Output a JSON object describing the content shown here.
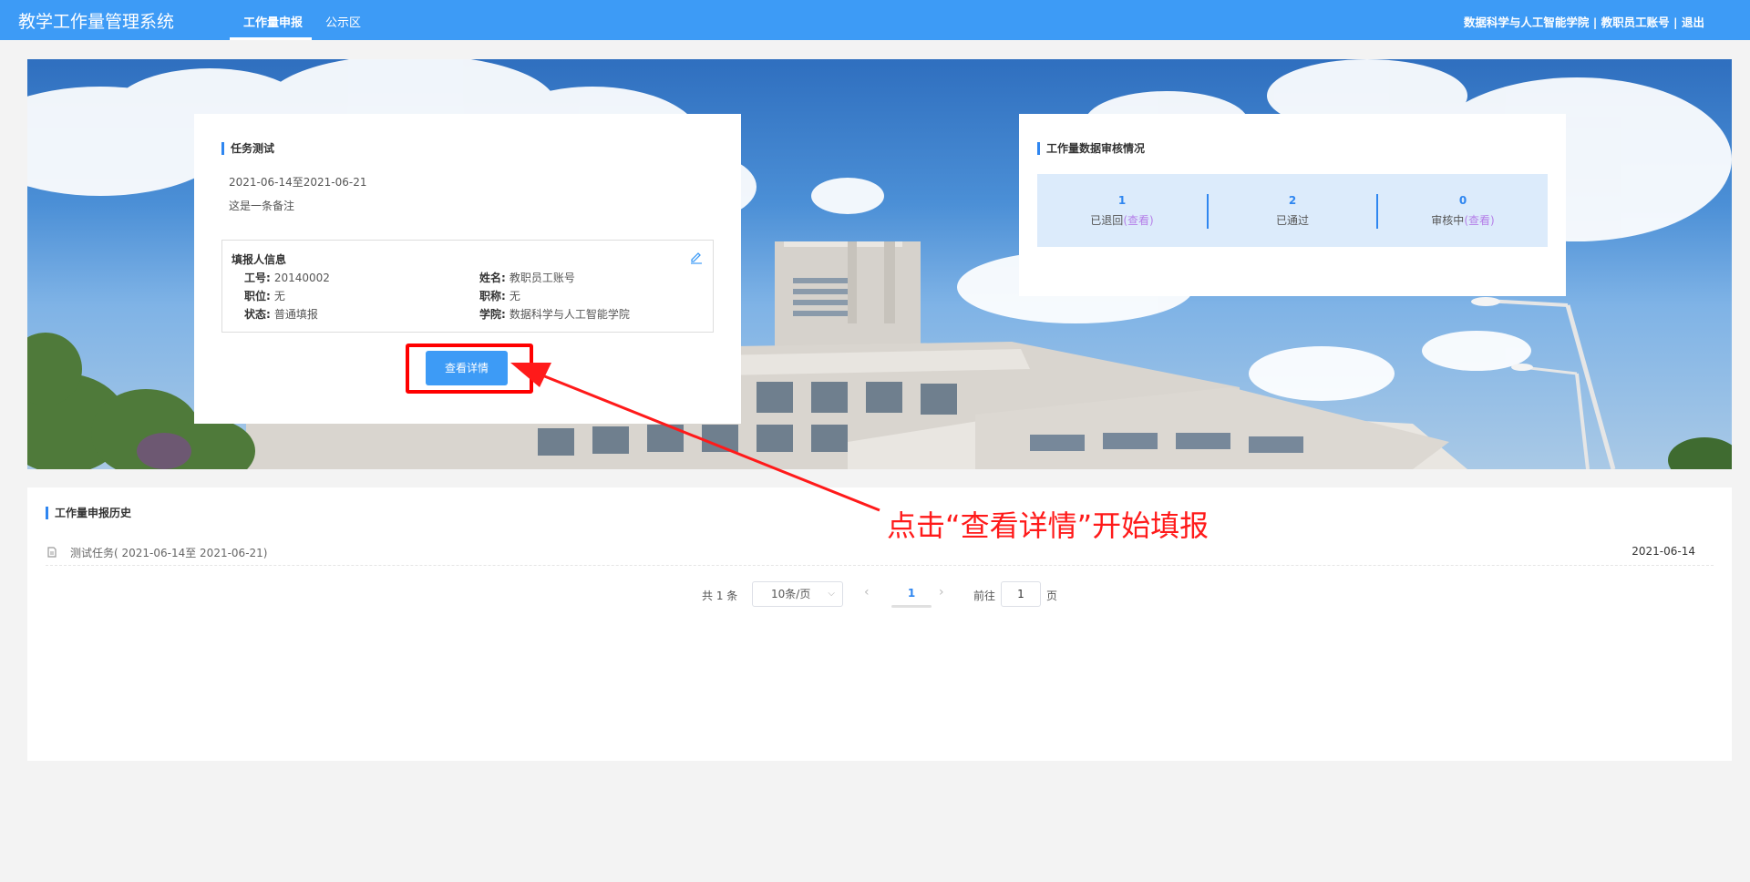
{
  "header": {
    "title": "教学工作量管理系统",
    "tabs": [
      "工作量申报",
      "公示区"
    ],
    "user": {
      "college": "数据科学与人工智能学院",
      "account": "教职员工账号",
      "logout": "退出",
      "sep": "|"
    }
  },
  "task": {
    "title": "任务测试",
    "date_range": "2021-06-14至2021-06-21",
    "remark": "这是一条备注",
    "info": {
      "title": "填报人信息",
      "fields": [
        {
          "label": "工号:",
          "value": "20140002"
        },
        {
          "label": "姓名:",
          "value": "教职员工账号"
        },
        {
          "label": "职位:",
          "value": "无"
        },
        {
          "label": "职称:",
          "value": "无"
        },
        {
          "label": "状态:",
          "value": "普通填报"
        },
        {
          "label": "学院:",
          "value": "数据科学与人工智能学院"
        }
      ]
    },
    "detail_button": "查看详情"
  },
  "audit": {
    "title": "工作量数据审核情况",
    "items": [
      {
        "count": "1",
        "label": "已退回",
        "link": "(查看)"
      },
      {
        "count": "2",
        "label": "已通过",
        "link": ""
      },
      {
        "count": "0",
        "label": "审核中",
        "link": "(查看)"
      }
    ]
  },
  "history": {
    "title": "工作量申报历史",
    "rows": [
      {
        "text": "测试任务( 2021-06-14至 2021-06-21)",
        "date": "2021-06-14"
      }
    ]
  },
  "pagination": {
    "total": "共 1 条",
    "page_size": "10条/页",
    "prev": "‹",
    "current": "1",
    "next": "›",
    "goto": "前往",
    "goto_value": "1",
    "page_suffix": "页"
  },
  "annotation": "点击“查看详情”开始填报",
  "colors": {
    "primary": "#3d9bf6",
    "accent_link": "#b57ee8",
    "annotation": "#ff1a1a"
  }
}
